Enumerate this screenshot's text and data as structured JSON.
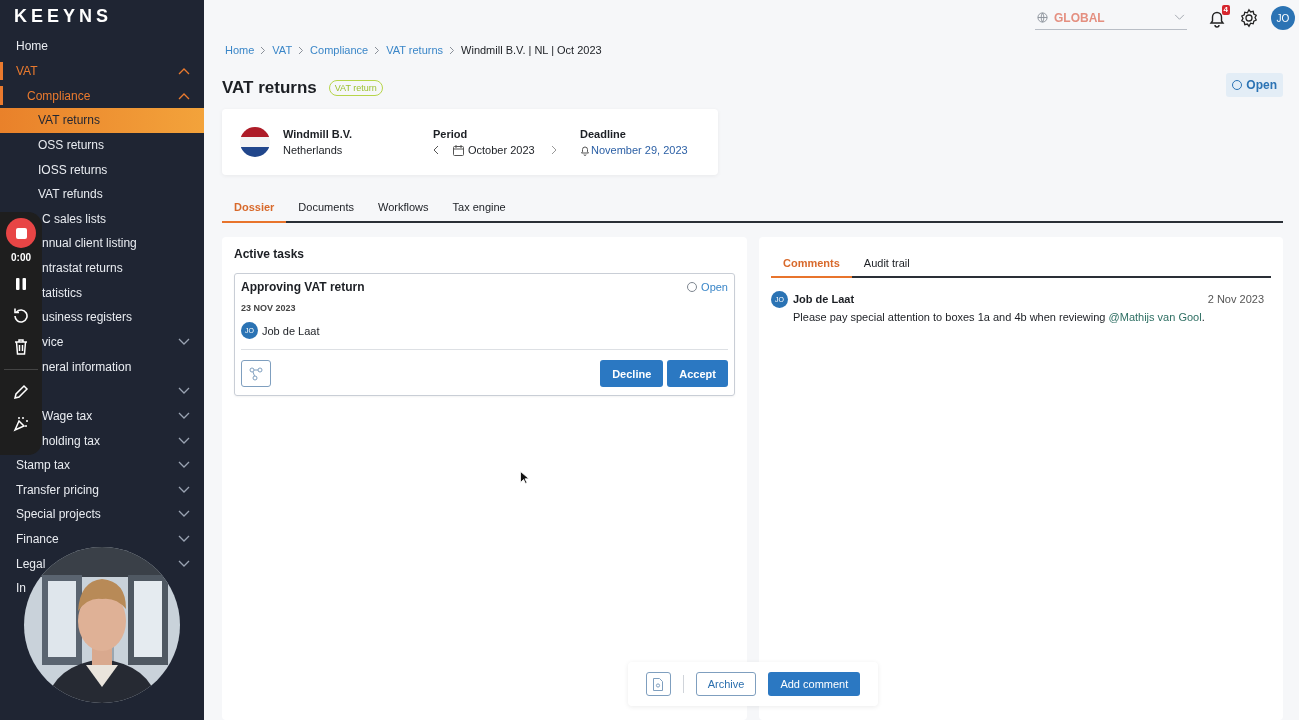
{
  "logo": "KEEYNS",
  "sidebar": {
    "items": [
      {
        "label": "Home",
        "selected": false
      },
      {
        "label": "VAT",
        "selected": false,
        "expanded": true,
        "children": [
          {
            "label": "Compliance",
            "selected": false,
            "expanded": true,
            "children": [
              {
                "label": "VAT returns",
                "selected": true
              },
              {
                "label": "OSS returns",
                "selected": false
              },
              {
                "label": "IOSS returns",
                "selected": false
              },
              {
                "label": "VAT refunds",
                "selected": false
              },
              {
                "label": "C sales lists",
                "selected": false,
                "clipped": true
              },
              {
                "label": "nnual client listing",
                "selected": false,
                "clipped": true
              },
              {
                "label": "ntrastat returns",
                "selected": false,
                "clipped": true
              },
              {
                "label": "tatistics",
                "selected": false,
                "clipped": true
              },
              {
                "label": "usiness registers",
                "selected": false,
                "clipped": true
              }
            ]
          },
          {
            "label": "vice",
            "selected": false,
            "expanded": false,
            "clipped": true
          },
          {
            "label": "neral information",
            "selected": false,
            "clipped": true
          }
        ]
      },
      {
        "selected": false,
        "expanded": false,
        "clipped": true
      },
      {
        "label": "Wage tax",
        "selected": false,
        "expanded": false,
        "clipped": true
      },
      {
        "label": "holding tax",
        "selected": false,
        "expanded": false,
        "clipped": true
      },
      {
        "label": "Stamp tax",
        "selected": false,
        "expanded": false
      },
      {
        "label": "Transfer pricing",
        "selected": false,
        "expanded": false
      },
      {
        "label": "Special projects",
        "selected": false,
        "expanded": false
      },
      {
        "label": "Finance",
        "selected": false,
        "expanded": false
      },
      {
        "label": "Legal",
        "selected": false,
        "expanded": false
      },
      {
        "label": "In",
        "selected": false
      }
    ]
  },
  "recorder": {
    "timer": "0:00"
  },
  "topbar": {
    "region": "GLOBAL",
    "notifications": "4",
    "avatar": "JO"
  },
  "breadcrumb": [
    {
      "label": "Home",
      "link": true
    },
    {
      "label": "VAT",
      "link": true
    },
    {
      "label": "Compliance",
      "link": true
    },
    {
      "label": "VAT returns",
      "link": true
    },
    {
      "label": "Windmill B.V. | NL | Oct 2023",
      "link": false
    }
  ],
  "page": {
    "title": "VAT returns",
    "tag": "VAT return",
    "status": "Open"
  },
  "entity": {
    "name": "Windmill B.V.",
    "country": "Netherlands",
    "period_label": "Period",
    "period": "October 2023",
    "deadline_label": "Deadline",
    "deadline": "November 29, 2023"
  },
  "tabs": [
    {
      "label": "Dossier",
      "selected": true
    },
    {
      "label": "Documents",
      "selected": false
    },
    {
      "label": "Workflows",
      "selected": false
    },
    {
      "label": "Tax engine",
      "selected": false
    }
  ],
  "tasks": {
    "heading": "Active tasks",
    "items": [
      {
        "title": "Approving VAT return",
        "status": "Open",
        "date": "23 NOV 2023",
        "initials": "JO",
        "assignee": "Job de Laat",
        "buttons": [
          "Decline",
          "Accept"
        ]
      }
    ]
  },
  "side_tabs": [
    {
      "label": "Comments",
      "selected": true
    },
    {
      "label": "Audit trail",
      "selected": false
    }
  ],
  "comments": [
    {
      "initials": "JO",
      "author": "Job de Laat",
      "date": "2 Nov 2023",
      "text": "Please pay special attention to boxes 1a and 4b when reviewing ",
      "mention": "@Mathijs van Gool",
      "tail": "."
    }
  ],
  "actions": {
    "archive": "Archive",
    "add": "Add comment"
  }
}
